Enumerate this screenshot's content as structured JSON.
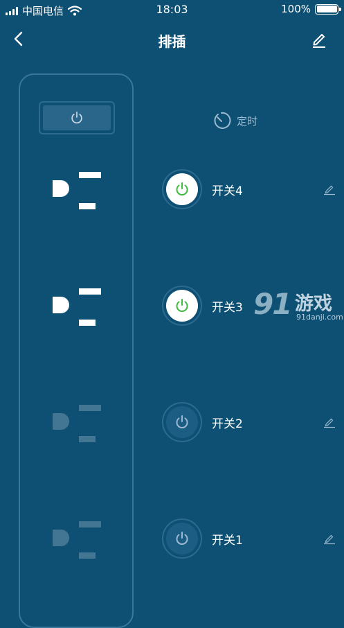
{
  "status_bar": {
    "carrier": "中国电信",
    "time": "18:03",
    "battery": "100%",
    "battery_level": 1.0
  },
  "nav": {
    "title": "排插",
    "back_icon": "chevron-left-icon",
    "edit_icon": "pencil-icon"
  },
  "timer": {
    "label": "定时",
    "icon": "timer-icon"
  },
  "switches": [
    {
      "label": "开关4",
      "state": "on"
    },
    {
      "label": "开关3",
      "state": "on"
    },
    {
      "label": "开关2",
      "state": "off"
    },
    {
      "label": "开关1",
      "state": "off"
    }
  ],
  "sockets": [
    {
      "state": "on"
    },
    {
      "state": "on"
    },
    {
      "state": "off"
    },
    {
      "state": "off"
    }
  ],
  "colors": {
    "background": "#0e5073",
    "power_on": "#3dbb3d",
    "power_off": "#9cbbd0",
    "outline": "#2d6a8f"
  },
  "watermark": {
    "number": "91",
    "text": "游戏",
    "site": "91danji.com"
  }
}
